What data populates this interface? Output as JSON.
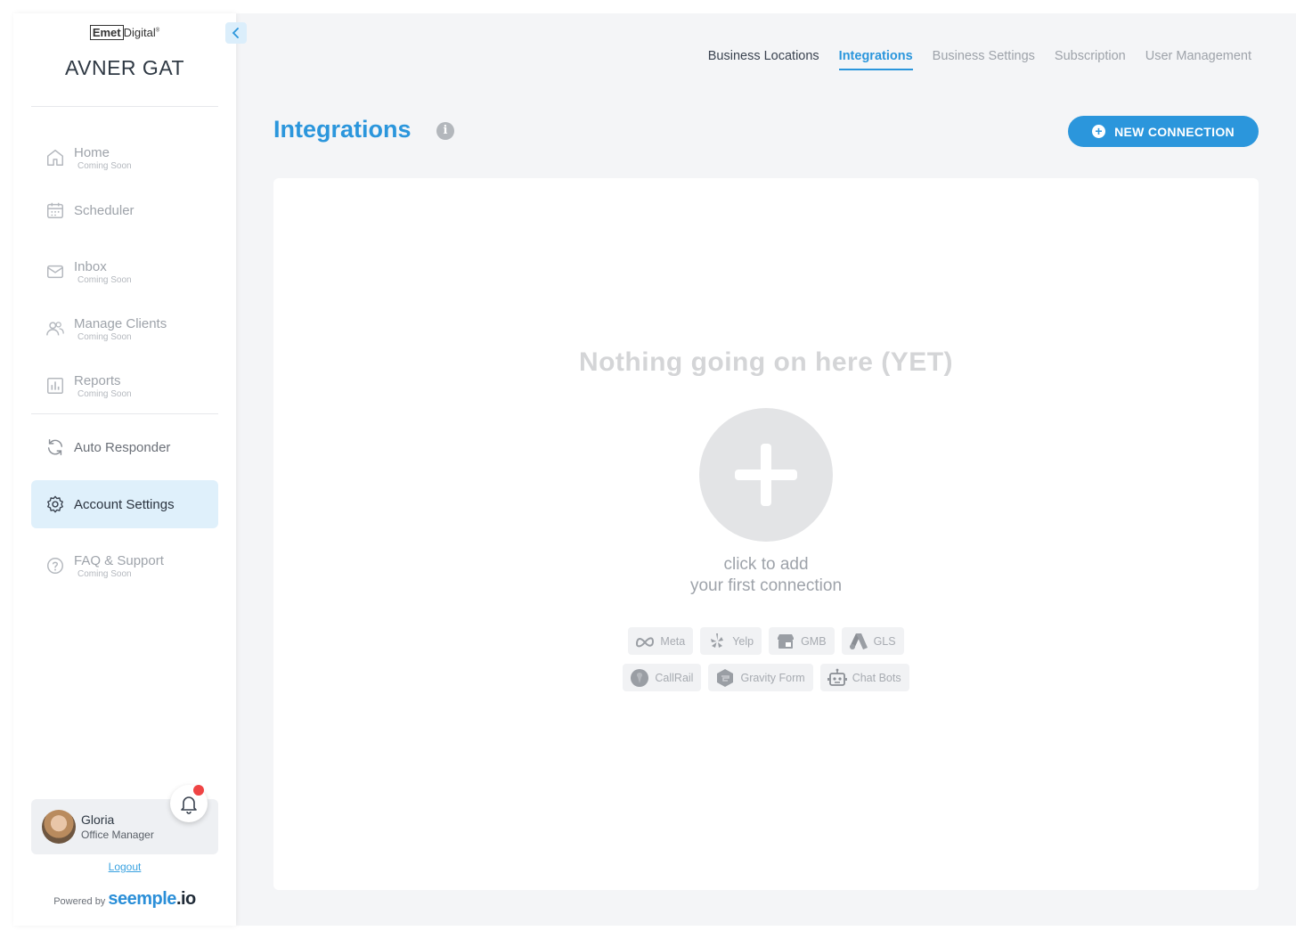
{
  "brand": {
    "logo_prefix": "Emet",
    "logo_suffix": "Digital",
    "logo_mark": "®"
  },
  "account": {
    "name": "AVNER GAT"
  },
  "sidebar": {
    "items": [
      {
        "label": "Home",
        "sub": "Coming Soon",
        "icon": "home-icon"
      },
      {
        "label": "Scheduler",
        "sub": "",
        "icon": "calendar-icon"
      },
      {
        "label": "Inbox",
        "sub": "Coming Soon",
        "icon": "mail-icon"
      },
      {
        "label": "Manage Clients",
        "sub": "Coming Soon",
        "icon": "users-icon"
      },
      {
        "label": "Reports",
        "sub": "Coming Soon",
        "icon": "chart-icon"
      },
      {
        "label": "Auto Responder",
        "sub": "",
        "icon": "refresh-icon"
      },
      {
        "label": "Account Settings",
        "sub": "",
        "icon": "gear-icon"
      },
      {
        "label": "FAQ & Support",
        "sub": "Coming Soon",
        "icon": "help-icon"
      }
    ],
    "active_item": "Account Settings"
  },
  "user": {
    "name": "Gloria",
    "role": "Office Manager",
    "logout": "Logout"
  },
  "footer": {
    "powered_by": "Powered by",
    "brand_main": "seemple",
    "brand_tld": ".io"
  },
  "tabs": [
    {
      "label": "Business Locations"
    },
    {
      "label": "Integrations"
    },
    {
      "label": "Business Settings"
    },
    {
      "label": "Subscription"
    },
    {
      "label": "User Management"
    }
  ],
  "active_tab": "Integrations",
  "page": {
    "title": "Integrations",
    "info": "i",
    "new_connection": "NEW CONNECTION",
    "empty_title": "Nothing going on here (YET)",
    "add_line1": "click to add",
    "add_line2": "your first connection"
  },
  "integrations_row1": [
    "Meta",
    "Yelp",
    "GMB",
    "GLS"
  ],
  "integrations_row2": [
    "CallRail",
    "Gravity Form",
    "Chat Bots"
  ],
  "colors": {
    "accent": "#2b96dc",
    "active_bg": "#dff0fb",
    "notification": "#ef4444"
  }
}
